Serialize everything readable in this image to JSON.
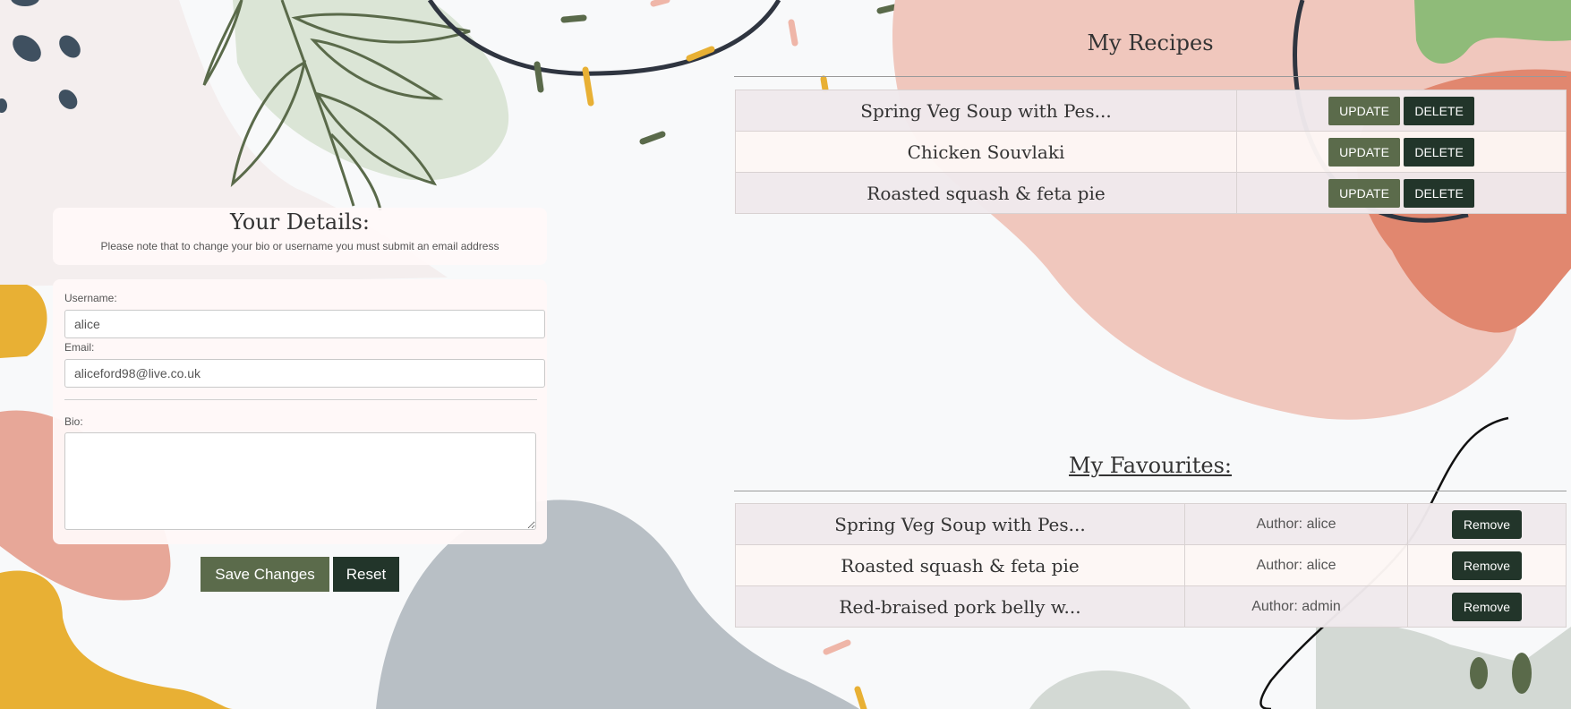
{
  "details": {
    "title": "Your Details:",
    "note": "Please note that to change your bio or username you must submit an email address",
    "username_label": "Username:",
    "username_value": "alice",
    "email_label": "Email:",
    "email_value": "aliceford98@live.co.uk",
    "bio_label": "Bio:",
    "bio_value": "",
    "save_label": "Save Changes",
    "reset_label": "Reset"
  },
  "my_recipes": {
    "title": "My Recipes",
    "update_label": "UPDATE",
    "delete_label": "DELETE",
    "rows": [
      {
        "name": "Spring Veg Soup with Pes..."
      },
      {
        "name": "Chicken Souvlaki"
      },
      {
        "name": "Roasted squash & feta pie"
      }
    ]
  },
  "my_favourites": {
    "title": "My Favourites:",
    "remove_label": "Remove",
    "rows": [
      {
        "name": "Spring Veg Soup with Pes...",
        "author": "Author: alice"
      },
      {
        "name": "Roasted squash & feta pie",
        "author": "Author: alice"
      },
      {
        "name": "Red-braised pork belly w...",
        "author": "Author: admin"
      }
    ]
  },
  "colors": {
    "button_green": "#5b6b4b",
    "button_dark": "#22352a",
    "page_bg": "#f8f9fa"
  }
}
